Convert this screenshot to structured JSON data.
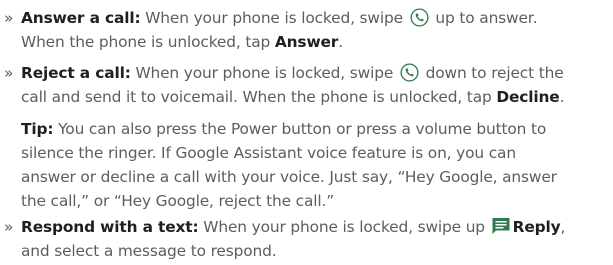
{
  "bullet_glyph": "»",
  "items": [
    {
      "lead": "Answer a call:",
      "line1_pre": " When your phone is locked, swipe ",
      "icon": "phone-call-icon",
      "line1_post": " up to answer.",
      "line2_pre": "When the phone is unlocked, tap ",
      "line2_bold": "Answer",
      "line2_post": "."
    },
    {
      "lead": "Reject a call:",
      "line1_pre": " When your phone is locked, swipe ",
      "icon": "phone-call-icon",
      "line1_post": " down to reject the",
      "line2_pre": "call and send it to voicemail. When the phone is unlocked, tap ",
      "line2_bold": "Decline",
      "line2_post": "."
    },
    {
      "lead": "Respond with a text:",
      "line1_pre": " When your phone is locked, swipe up ",
      "icon": "message-icon",
      "line1_bold": "Reply",
      "line1_post": ",",
      "line2": "and select a message to respond."
    }
  ],
  "tip": {
    "label": "Tip:",
    "line1": " You can also press the Power button or press a volume button to",
    "line2": "silence the ringer. If Google Assistant voice feature is on, you can",
    "line3": "answer or decline a call with your voice. Just say, “Hey Google, answer",
    "line4": "the call,” or “Hey Google, reject the call.”"
  },
  "colors": {
    "text": "#5d5d5d",
    "bold_text": "#1f1f1f",
    "icon_accent": "#2e7d4a"
  }
}
